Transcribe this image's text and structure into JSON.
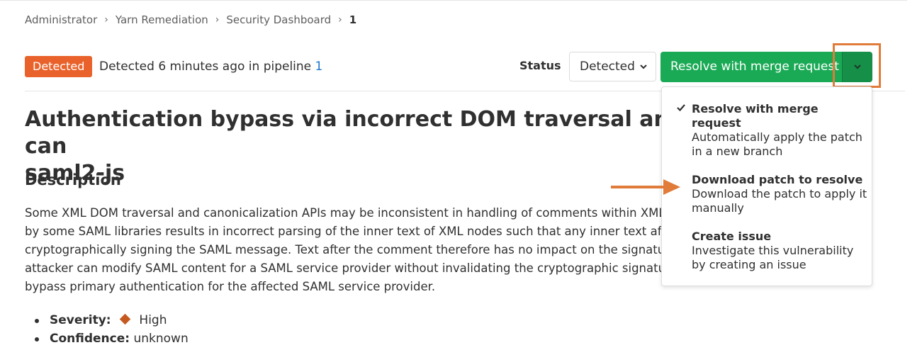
{
  "breadcrumb": {
    "items": [
      "Administrator",
      "Yarn Remediation",
      "Security Dashboard"
    ],
    "current": "1",
    "separator": "›"
  },
  "header": {
    "badge": "Detected",
    "detected_prefix": "Detected 6 minutes ago in pipeline ",
    "pipeline_link": "1",
    "status_label": "Status",
    "status_value": "Detected",
    "resolve_button": "Resolve with merge request",
    "badge_color": "#e9622b",
    "button_color": "#1aaa55"
  },
  "content": {
    "title": "Authentication bypass via incorrect DOM traversal and can saml2-js",
    "title_line1": "Authentication bypass via incorrect DOM traversal and can",
    "title_line2": "saml2-js",
    "description_heading": "Description",
    "description_lines": [
      "Some XML DOM traversal and canonicalization APIs may be inconsistent in handling of comments within XML",
      "by some SAML libraries results in incorrect parsing of the inner text of XML nodes such that any inner text afte",
      "cryptographically signing the SAML message. Text after the comment therefore has no impact on the signatur",
      "attacker can modify SAML content for a SAML service provider without invalidating the cryptographic signatur",
      "bypass primary authentication for the affected SAML service provider."
    ],
    "severity_label": "Severity:",
    "severity_value": "High",
    "confidence_label": "Confidence:",
    "confidence_value": "unknown"
  },
  "dropdown": {
    "items": [
      {
        "title": "Resolve with merge request",
        "description": "Automatically apply the patch in a new branch",
        "checked": true
      },
      {
        "title": "Download patch to resolve",
        "description": "Download the patch to apply it manually",
        "checked": false
      },
      {
        "title": "Create issue",
        "description": "Investigate this vulnerability by creating an issue",
        "checked": false
      }
    ]
  },
  "annotation_color": "#e07b39"
}
